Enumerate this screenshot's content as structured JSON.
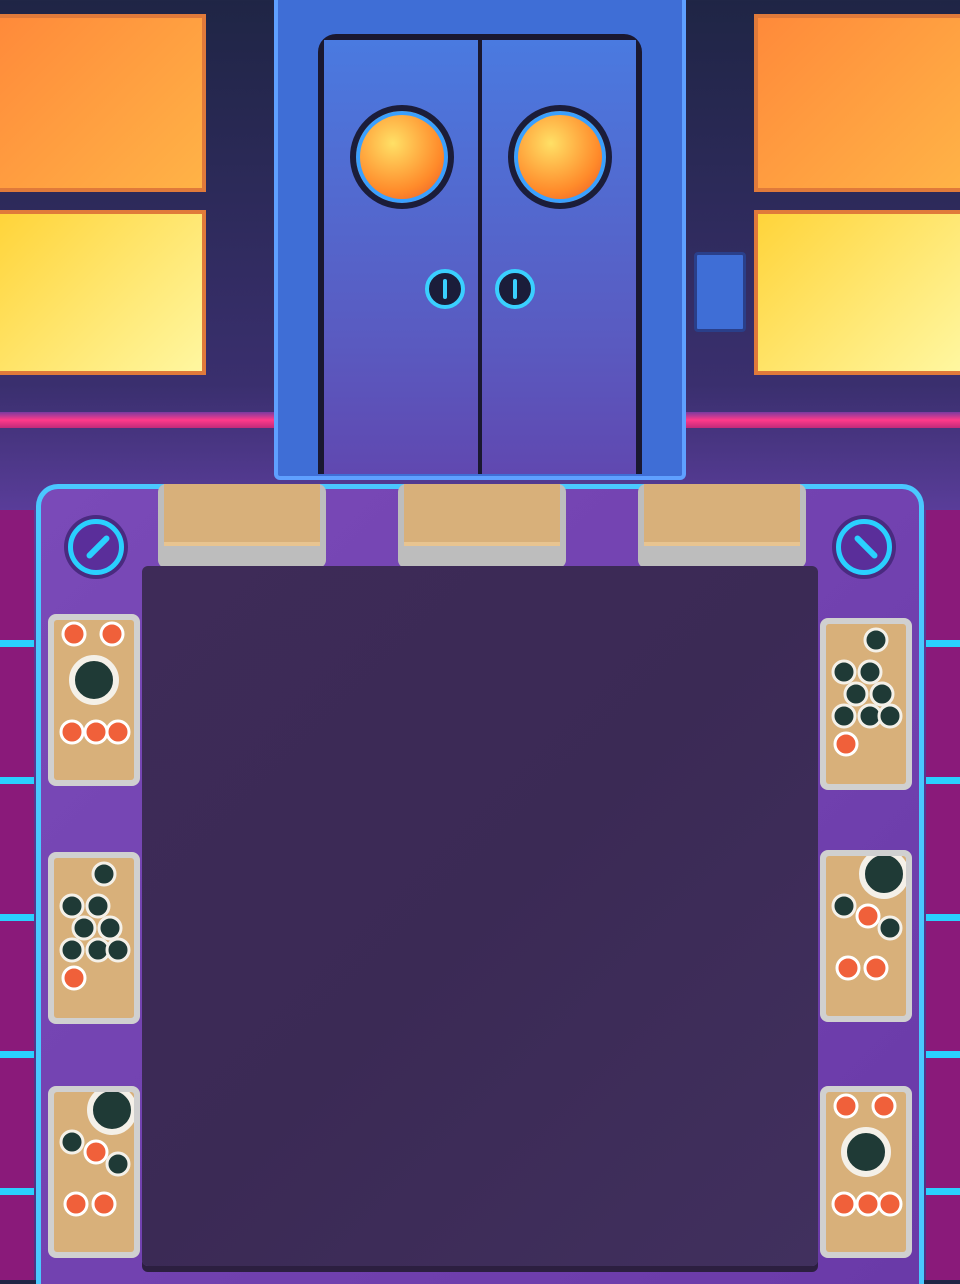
{
  "colors": {
    "accent": "#2ad0ff",
    "counter": "#6a3aa8",
    "board": "#3d2a55",
    "wood": "#d8b07a",
    "door": "#4a7ae0"
  },
  "sushi_plates": {
    "left": [
      "mixed-platter",
      "maki-roll-stack",
      "nigiri-assortment"
    ],
    "right": [
      "maki-roll-stack",
      "nigiri-assortment",
      "mixed-platter"
    ]
  }
}
